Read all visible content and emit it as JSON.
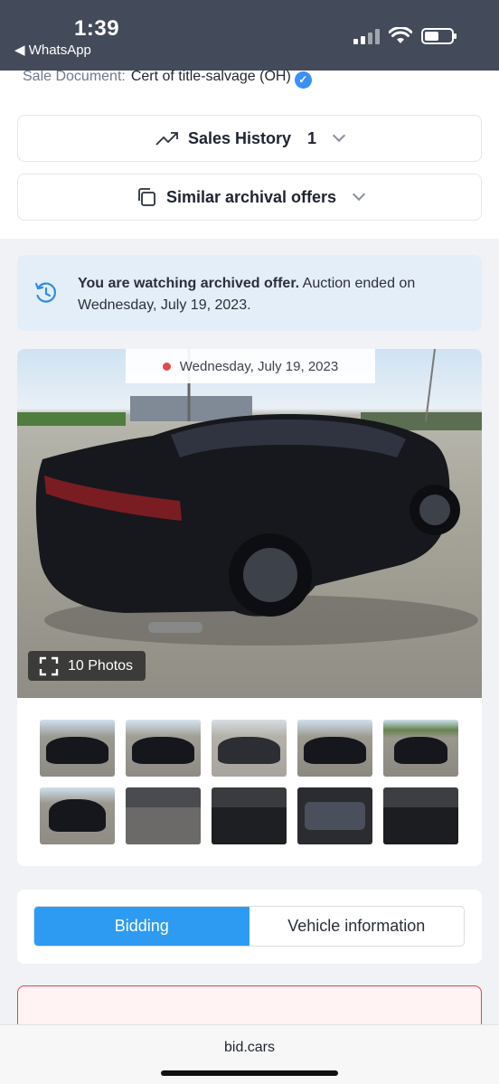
{
  "status_bar": {
    "time": "1:39",
    "back_label": "◀ WhatsApp"
  },
  "sale_document": {
    "label": "Sale Document:",
    "value": "Cert of title-salvage (OH)"
  },
  "sales_history": {
    "label": "Sales History",
    "count": "1"
  },
  "similar_offers": {
    "label": "Similar archival offers"
  },
  "archived_notice": {
    "bold": "You are watching archived offer.",
    "text": " Auction ended on Wednesday, July 19, 2023."
  },
  "photo": {
    "date": "Wednesday, July 19, 2023",
    "photos_button": "10 Photos"
  },
  "thumbnails": [
    {
      "name": "thumb-1",
      "kind": "ext"
    },
    {
      "name": "thumb-2",
      "kind": "ext"
    },
    {
      "name": "thumb-3",
      "kind": "ext"
    },
    {
      "name": "thumb-4",
      "kind": "ext"
    },
    {
      "name": "thumb-5",
      "kind": "ext"
    },
    {
      "name": "thumb-6",
      "kind": "ext"
    },
    {
      "name": "thumb-7",
      "kind": "int"
    },
    {
      "name": "thumb-8",
      "kind": "int"
    },
    {
      "name": "thumb-9",
      "kind": "int"
    },
    {
      "name": "thumb-10",
      "kind": "int"
    }
  ],
  "tabs": {
    "active": "Bidding",
    "other": "Vehicle information"
  },
  "browser": {
    "url": "bid.cars"
  },
  "colors": {
    "accent": "#2e9bf2",
    "notice_bg": "#e4eef9",
    "alert_border": "#e0424b"
  }
}
